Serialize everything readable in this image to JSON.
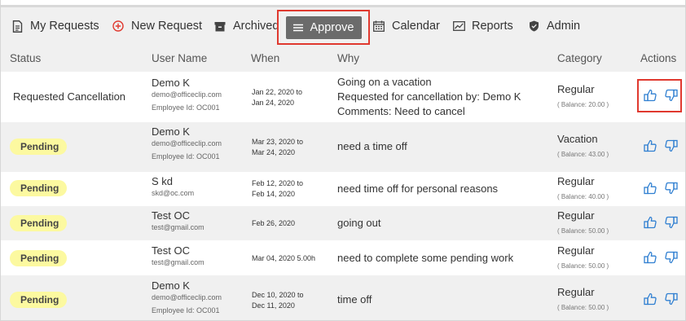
{
  "toolbar": {
    "items": [
      {
        "label": "My Requests",
        "icon": "document-icon"
      },
      {
        "label": "New Request",
        "icon": "plus-circle-icon"
      },
      {
        "label": "Archived",
        "icon": "archive-box-icon"
      },
      {
        "label": "Approve",
        "icon": "list-icon",
        "active": true
      },
      {
        "label": "Calendar",
        "icon": "calendar-icon"
      },
      {
        "label": "Reports",
        "icon": "chart-icon"
      },
      {
        "label": "Admin",
        "icon": "shield-icon"
      }
    ]
  },
  "table": {
    "headers": {
      "status": "Status",
      "user": "User Name",
      "when": "When",
      "why": "Why",
      "category": "Category",
      "actions": "Actions"
    },
    "rows": [
      {
        "status": "Requested Cancellation",
        "name": "Demo K",
        "email": "demo@officeclip.com",
        "employee": "Employee Id: OC001",
        "when1": "Jan 22, 2020 to",
        "when2": "Jan 24, 2020",
        "why1": "Going on a vacation",
        "why2": "Requested for cancellation by: Demo K",
        "why3": "Comments: Need to cancel",
        "category": "Regular",
        "balance": "( Balance: 20.00 )"
      },
      {
        "status": "Pending",
        "name": "Demo K",
        "email": "demo@officeclip.com",
        "employee": "Employee Id: OC001",
        "when1": "Mar 23, 2020 to",
        "when2": "Mar 24, 2020",
        "why1": "need a time off",
        "category": "Vacation",
        "balance": "( Balance: 43.00 )"
      },
      {
        "status": "Pending",
        "name": "S kd",
        "email": "skd@oc.com",
        "when1": "Feb 12, 2020 to",
        "when2": "Feb 14, 2020",
        "why1": "need time off for personal reasons",
        "category": "Regular",
        "balance": "( Balance: 40.00 )"
      },
      {
        "status": "Pending",
        "name": "Test OC",
        "email": "test@gmail.com",
        "when1": "Feb 26, 2020",
        "why1": "going out",
        "category": "Regular",
        "balance": "( Balance: 50.00 )"
      },
      {
        "status": "Pending",
        "name": "Test OC",
        "email": "test@gmail.com",
        "when1": "Mar 04, 2020 5.00h",
        "why1": "need to complete some pending work",
        "category": "Regular",
        "balance": "( Balance: 50.00 )"
      },
      {
        "status": "Pending",
        "name": "Demo K",
        "email": "demo@officeclip.com",
        "employee": "Employee Id: OC001",
        "when1": "Dec 10, 2020 to",
        "when2": "Dec 11, 2020",
        "why1": "time off",
        "category": "Regular",
        "balance": "( Balance: 50.00 )"
      }
    ]
  },
  "colors": {
    "highlight": "#e0392f",
    "badge": "#fcf9a0",
    "action_icon": "#2f7fd1",
    "active_button": "#6b6b6b"
  }
}
